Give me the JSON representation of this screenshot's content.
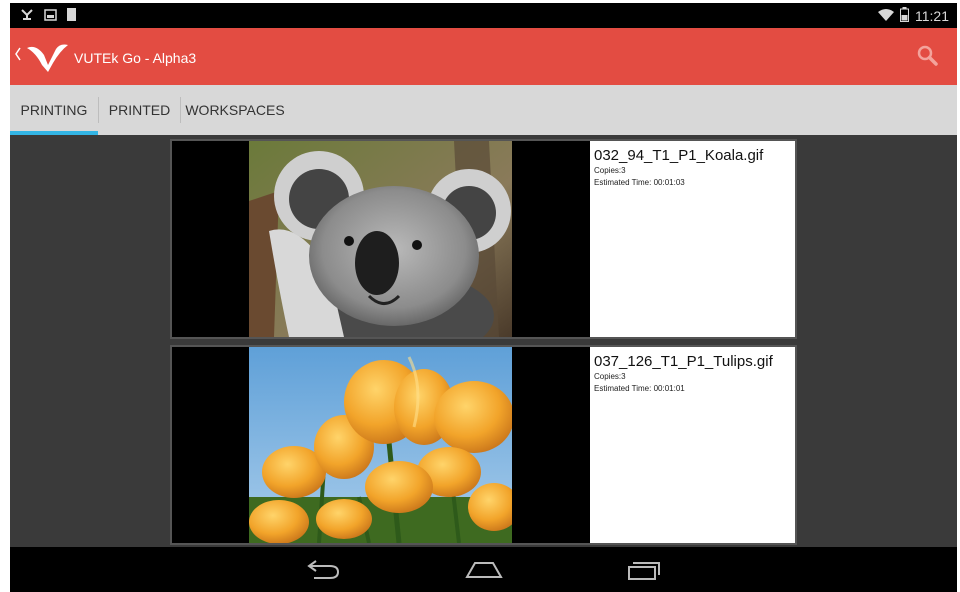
{
  "statusbar": {
    "time": "11:21",
    "icons": [
      "usb-icon",
      "image-notification-icon",
      "battery-notification-icon",
      "wifi-icon",
      "battery-icon"
    ]
  },
  "actionbar": {
    "title": "VUTEk Go - Alpha3",
    "logo": "vutek-logo",
    "search_icon": "search-icon",
    "color": "#e34c42"
  },
  "tabs": [
    {
      "label": "PRINTING",
      "active": true
    },
    {
      "label": "PRINTED",
      "active": false
    },
    {
      "label": "WORKSPACES",
      "active": false
    }
  ],
  "jobs": [
    {
      "filename": "032_94_T1_P1_Koala.gif",
      "copies": "Copies:3",
      "estimated_time": "Estimated Time: 00:01:03"
    },
    {
      "filename": "037_126_T1_P1_Tulips.gif",
      "copies": "Copies:3",
      "estimated_time": "Estimated Time: 00:01:01"
    }
  ],
  "navbar": {
    "icons": [
      "back-icon",
      "home-icon",
      "recent-apps-icon"
    ]
  },
  "colors": {
    "accent_tab_indicator": "#33b5e5",
    "content_bg": "#3a3a3a",
    "tab_bg": "#d8d8d8"
  }
}
